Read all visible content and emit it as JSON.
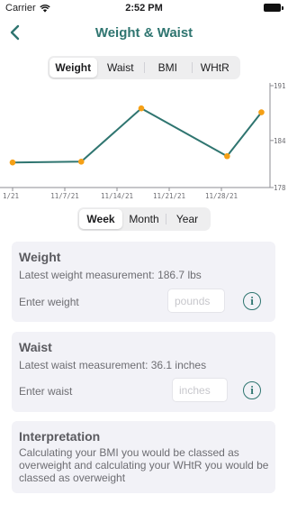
{
  "status_bar": {
    "carrier": "Carrier",
    "time": "2:52 PM"
  },
  "nav": {
    "title": "Weight & Waist"
  },
  "metric_tabs": [
    "Weight",
    "Waist",
    "BMI",
    "WHtR"
  ],
  "metric_selected": "Weight",
  "range_tabs": [
    "Week",
    "Month",
    "Year"
  ],
  "range_selected": "Week",
  "weight_card": {
    "title": "Weight",
    "latest": "Latest weight measurement: 186.7 lbs",
    "label": "Enter weight",
    "placeholder": "pounds"
  },
  "waist_card": {
    "title": "Waist",
    "latest": "Latest waist measurement: 36.1 inches",
    "label": "Enter waist",
    "placeholder": "inches"
  },
  "interpretation_card": {
    "title": "Interpretation",
    "text": "Calculating your BMI you would be classed as overweight and calculating your WHtR you would be classed as overweight"
  },
  "colors": {
    "accent": "#2f7570",
    "point": "#f5a016"
  },
  "chart_data": {
    "type": "line",
    "x_ticks": [
      "1/21",
      "11/7/21",
      "11/14/21",
      "11/21/21",
      "11/28/21"
    ],
    "y_ticks": [
      178,
      184,
      191
    ],
    "ylim": [
      178,
      191
    ],
    "xlim": [
      "10/31/21",
      "11/30/21"
    ],
    "series": [
      {
        "x": [
          "10/31/21",
          "11/8/21",
          "11/15/21",
          "11/25/21",
          "11/29/21"
        ],
        "values": [
          181.2,
          181.3,
          188.1,
          182.0,
          187.6
        ]
      }
    ],
    "grid": false,
    "axis_side": "right"
  }
}
